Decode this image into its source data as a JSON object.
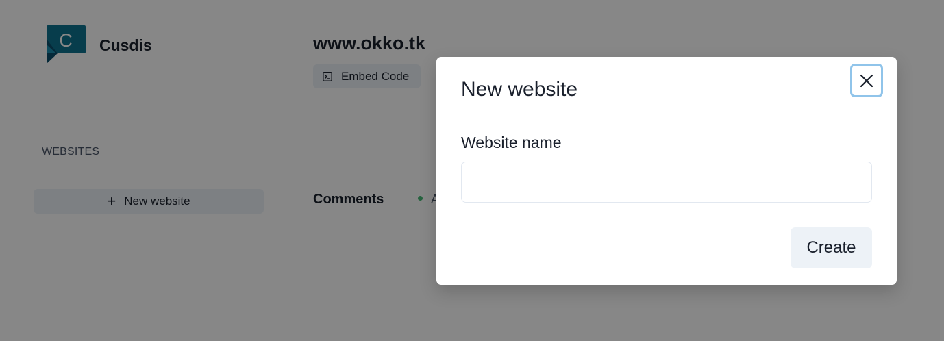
{
  "app": {
    "brand_name": "Cusdis",
    "logo_letter": "C",
    "logo_icon": "cusdis-logo-icon"
  },
  "sidebar": {
    "heading": "WEBSITES",
    "new_website_icon": "plus-icon",
    "new_website_label": "New website"
  },
  "main": {
    "site_title": "www.okko.tk",
    "embed_icon": "terminal-icon",
    "embed_label": "Embed Code",
    "comments_label": "Comments",
    "approved_tab_text": "A"
  },
  "modal": {
    "title": "New website",
    "close_icon": "close-icon",
    "field_label": "Website name",
    "input_value": "",
    "input_placeholder": "",
    "submit_label": "Create"
  },
  "colors": {
    "brand_teal": "#0e7490",
    "brand_teal_dark": "#0b4f6c",
    "overlay": "rgba(0,0,0,0.47)",
    "focus_ring": "#90c4ea",
    "button_bg": "#edf2f7",
    "approved_dot": "#48bb78"
  }
}
